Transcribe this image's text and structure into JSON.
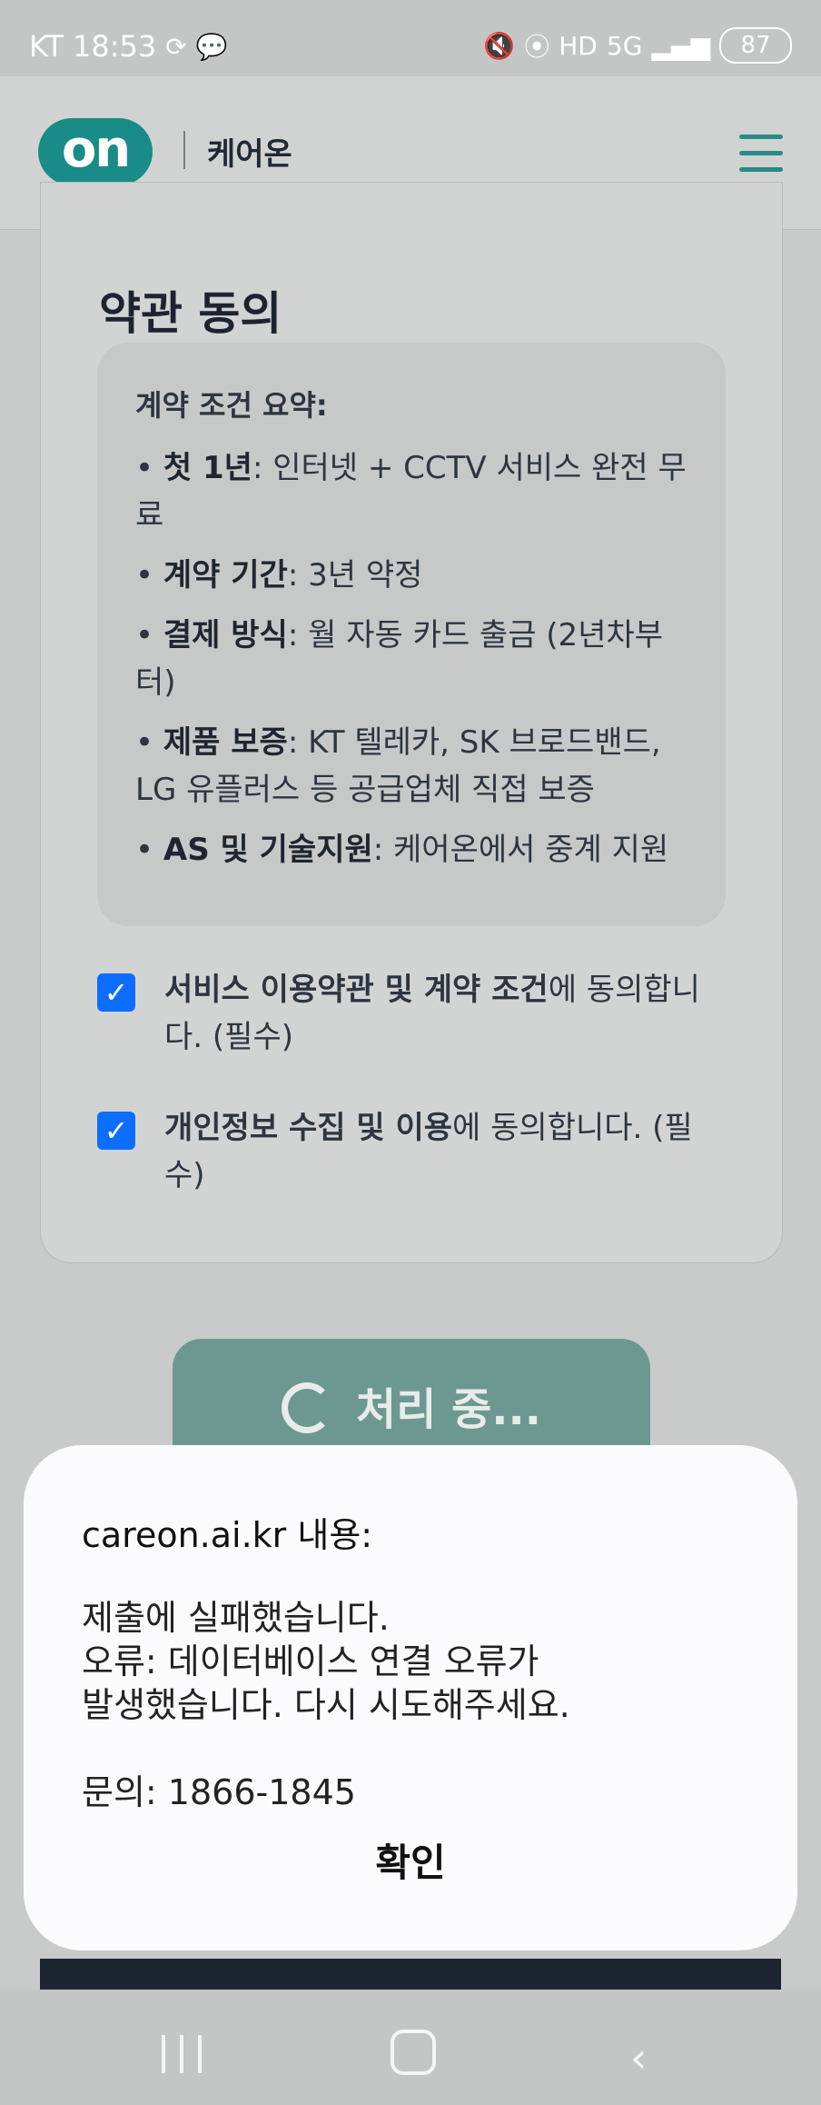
{
  "status_bar": {
    "carrier": "KT",
    "time": "18:53",
    "battery": "87",
    "icons": [
      "refresh-icon",
      "chat-icon",
      "mute-icon",
      "signal-icon",
      "hd-icon",
      "5g-icon",
      "cell-signal-icon",
      "battery-icon"
    ]
  },
  "header": {
    "logo_text": "on",
    "brand_name": "케어온",
    "menu_icon": "hamburger-menu-icon"
  },
  "terms": {
    "title": "약관 동의",
    "summary_title": "계약 조건 요약:",
    "items": [
      {
        "bold": "첫 1년",
        "text": ": 인터넷 + CCTV 서비스 완전 무료"
      },
      {
        "bold": "계약 기간",
        "text": ": 3년 약정"
      },
      {
        "bold": "결제 방식",
        "text": ": 월 자동 카드 출금 (2년차부터)"
      },
      {
        "bold": "제품 보증",
        "text": ": KT 텔레카, SK 브로드밴드, LG 유플러스 등 공급업체 직접 보증"
      },
      {
        "bold": "AS 및 기술지원",
        "text": ": 케어온에서 중계 지원"
      }
    ],
    "checkboxes": [
      {
        "bold": "서비스 이용약관 및 계약 조건",
        "text": "에 동의합니다. (필수)",
        "checked": true
      },
      {
        "bold": "개인정보 수집 및 이용",
        "text": "에 동의합니다. (필수)",
        "checked": true
      }
    ]
  },
  "submit_button": {
    "label": "처리 중..."
  },
  "dialog": {
    "title": "careon.ai.kr 내용:",
    "message": "제출에 실패했습니다.\n오류: 데이터베이스 연결 오류가\n발생했습니다. 다시 시도해주세요.\n\n문의: 1866-1845",
    "ok_label": "확인"
  },
  "colors": {
    "brand": "#198c88",
    "checkbox": "#0d6efd",
    "button_disabled": "#6d9891"
  }
}
